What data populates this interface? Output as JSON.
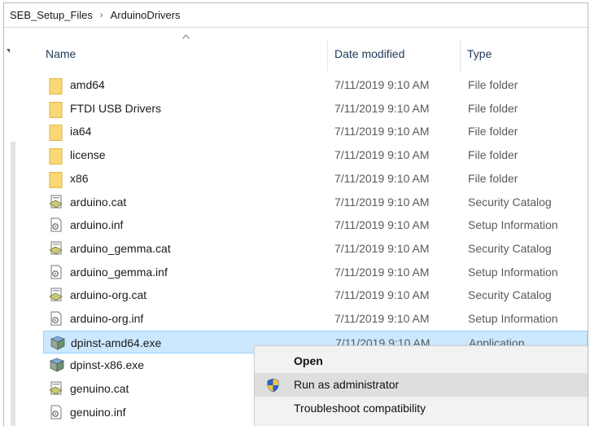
{
  "breadcrumb": {
    "part1": "SEB_Setup_Files",
    "separator": "›",
    "part2": "ArduinoDrivers"
  },
  "columns": {
    "name": "Name",
    "date": "Date modified",
    "type": "Type"
  },
  "files": [
    {
      "name": "amd64",
      "date": "7/11/2019 9:10 AM",
      "type": "File folder",
      "icon": "folder-icon"
    },
    {
      "name": "FTDI USB Drivers",
      "date": "7/11/2019 9:10 AM",
      "type": "File folder",
      "icon": "folder-icon"
    },
    {
      "name": "ia64",
      "date": "7/11/2019 9:10 AM",
      "type": "File folder",
      "icon": "folder-icon"
    },
    {
      "name": "license",
      "date": "7/11/2019 9:10 AM",
      "type": "File folder",
      "icon": "folder-icon"
    },
    {
      "name": "x86",
      "date": "7/11/2019 9:10 AM",
      "type": "File folder",
      "icon": "folder-icon"
    },
    {
      "name": "arduino.cat",
      "date": "7/11/2019 9:10 AM",
      "type": "Security Catalog",
      "icon": "catalog-icon"
    },
    {
      "name": "arduino.inf",
      "date": "7/11/2019 9:10 AM",
      "type": "Setup Information",
      "icon": "setup-info-icon"
    },
    {
      "name": "arduino_gemma.cat",
      "date": "7/11/2019 9:10 AM",
      "type": "Security Catalog",
      "icon": "catalog-icon"
    },
    {
      "name": "arduino_gemma.inf",
      "date": "7/11/2019 9:10 AM",
      "type": "Setup Information",
      "icon": "setup-info-icon"
    },
    {
      "name": "arduino-org.cat",
      "date": "7/11/2019 9:10 AM",
      "type": "Security Catalog",
      "icon": "catalog-icon"
    },
    {
      "name": "arduino-org.inf",
      "date": "7/11/2019 9:10 AM",
      "type": "Setup Information",
      "icon": "setup-info-icon"
    },
    {
      "name": "dpinst-amd64.exe",
      "date": "7/11/2019 9:10 AM",
      "type": "Application",
      "icon": "installer-icon",
      "selected": true
    },
    {
      "name": "dpinst-x86.exe",
      "date": "",
      "type": "",
      "icon": "installer-icon"
    },
    {
      "name": "genuino.cat",
      "date": "",
      "type": "",
      "icon": "catalog-icon"
    },
    {
      "name": "genuino.inf",
      "date": "",
      "type": "",
      "icon": "setup-info-icon"
    }
  ],
  "context_menu": {
    "items": [
      {
        "label": "Open",
        "bold": true
      },
      {
        "label": "Run as administrator",
        "icon": "uac-shield-icon",
        "hover": true
      },
      {
        "label": "Troubleshoot compatibility"
      }
    ]
  },
  "colors": {
    "selection_bg": "#cce8ff",
    "selection_border": "#99d1ff",
    "folder": "#f8d775",
    "menu_bg": "#f2f2f2"
  }
}
